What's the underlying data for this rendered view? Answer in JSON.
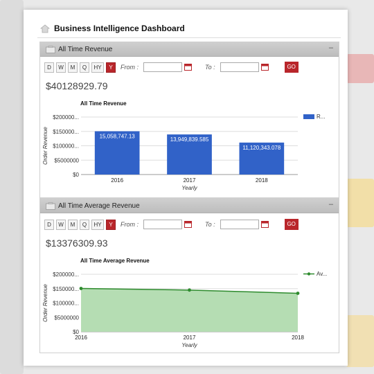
{
  "dashboard": {
    "title": "Business Intelligence Dashboard"
  },
  "period_buttons": [
    "D",
    "W",
    "M",
    "Q",
    "HY",
    "Y"
  ],
  "active_period": "Y",
  "filters": {
    "from_label": "From :",
    "to_label": "To :",
    "go_label": "GO",
    "from_value": "",
    "to_value": ""
  },
  "widgets": [
    {
      "header": "All Time Revenue",
      "collapse": "–",
      "total": "$40128929.79",
      "chart_title": "All Time Revenue",
      "legend": "R...",
      "xlabel": "Yearly",
      "ylabel": "Order Revenue"
    },
    {
      "header": "All Time Average Revenue",
      "collapse": "–",
      "total": "$13376309.93",
      "chart_title": "All Time Average Revenue",
      "legend": "Av...",
      "xlabel": "Yearly",
      "ylabel": "Order Revenue"
    }
  ],
  "colors": {
    "bar": "#3162c8",
    "area_fill": "#b5ddb3",
    "area_line": "#2e8b2e",
    "go": "#b9262b"
  },
  "chart_data": [
    {
      "type": "bar",
      "title": "All Time Revenue",
      "categories": [
        "2016",
        "2017",
        "2018"
      ],
      "values": [
        15058747.13,
        13949839.585,
        11120343.078
      ],
      "value_labels": [
        "15,058,747.13",
        "13,949,839.585",
        "11,120,343.078"
      ],
      "ylim": [
        0,
        20000000
      ],
      "yticks": [
        "$0",
        "$5000000",
        "$100000...",
        "$150000...",
        "$200000..."
      ],
      "xlabel": "Yearly",
      "ylabel": "Order Revenue",
      "legend": "R...",
      "legend_position": "top-right",
      "grid": true
    },
    {
      "type": "area",
      "title": "All Time Average Revenue",
      "categories": [
        "2016",
        "2017",
        "2018"
      ],
      "values": [
        15058747.13,
        14500000,
        13376309.93
      ],
      "ylim": [
        0,
        20000000
      ],
      "yticks": [
        "$0",
        "$5000000",
        "$100000...",
        "$150000...",
        "$200000..."
      ],
      "xlabel": "Yearly",
      "ylabel": "Order Revenue",
      "legend": "Av...",
      "legend_position": "top-right",
      "grid": true
    }
  ]
}
